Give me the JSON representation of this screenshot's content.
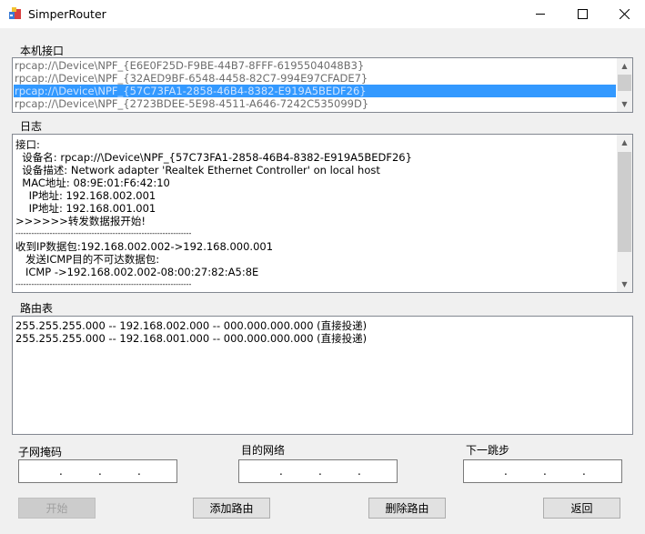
{
  "window": {
    "title": "SimperRouter",
    "minimize": "—",
    "maximize": "☐",
    "close": "✕"
  },
  "interfaces": {
    "label": "本机接口",
    "items": [
      "rpcap://\\Device\\NPF_{E6E0F25D-F9BE-44B7-8FFF-6195504048B3}",
      "rpcap://\\Device\\NPF_{32AED9BF-6548-4458-82C7-994E97CFADE7}",
      "rpcap://\\Device\\NPF_{57C73FA1-2858-46B4-8382-E919A5BEDF26}",
      "rpcap://\\Device\\NPF_{2723BDEE-5E98-4511-A646-7242C535099D}"
    ],
    "selected_index": 2
  },
  "log": {
    "label": "日志",
    "lines": [
      "接口:",
      "  设备名: rpcap://\\Device\\NPF_{57C73FA1-2858-46B4-8382-E919A5BEDF26}",
      "  设备描述: Network adapter 'Realtek Ethernet Controller' on local host",
      "  MAC地址: 08:9E:01:F6:42:10",
      "    IP地址: 192.168.002.001",
      "    IP地址: 192.168.001.001",
      ">>>>>>转发数据报开始!",
      "-------------------------------------------------------------------",
      "收到IP数据包:192.168.002.002->192.168.000.001",
      "   发送ICMP目的不可达数据包:",
      "   ICMP ->192.168.002.002-08:00:27:82:A5:8E",
      "-------------------------------------------------------------------"
    ]
  },
  "routes": {
    "label": "路由表",
    "lines": [
      "255.255.255.000 -- 192.168.002.000 -- 000.000.000.000 (直接投递)",
      "255.255.255.000 -- 192.168.001.000 -- 000.000.000.000 (直接投递)"
    ]
  },
  "fields": {
    "mask_label": "子网掩码",
    "dest_label": "目的网络",
    "next_label": "下一跳步",
    "dot": "."
  },
  "buttons": {
    "start": "开始",
    "add_route": "添加路由",
    "delete_route": "删除路由",
    "back": "返回"
  }
}
